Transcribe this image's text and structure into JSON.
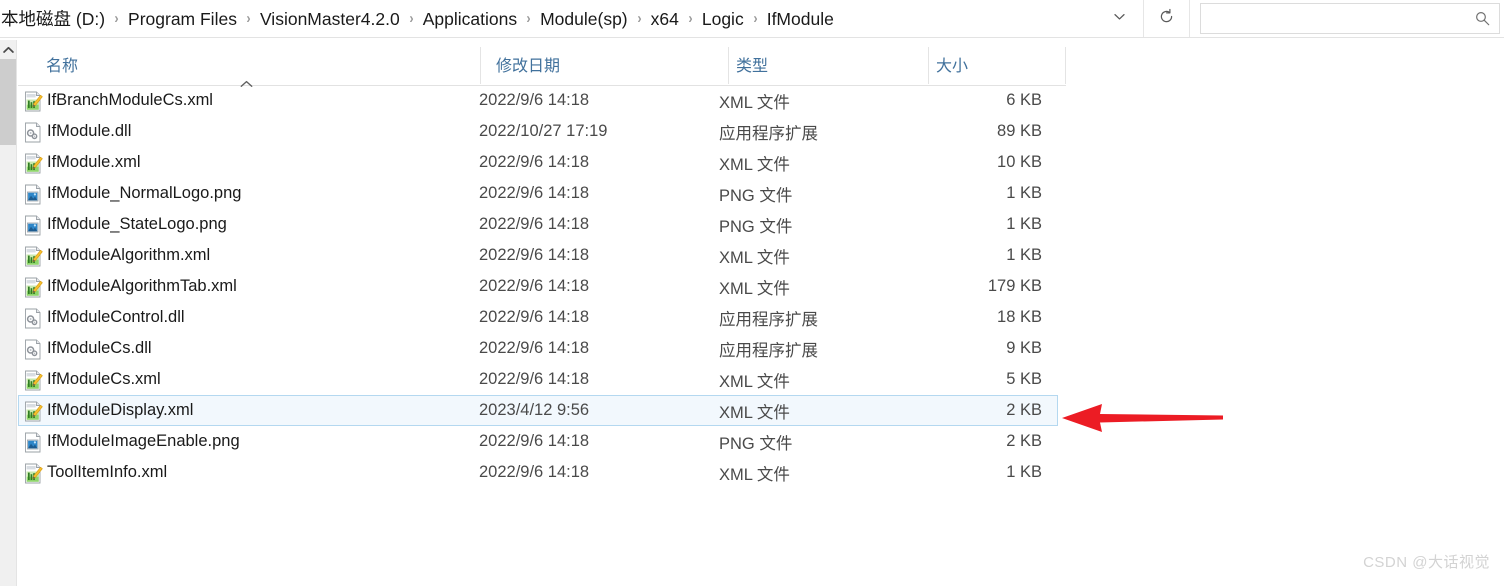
{
  "window": {
    "title": "IfModule"
  },
  "addressbar": {
    "breadcrumbs": [
      "本地磁盘 (D:)",
      "Program Files",
      "VisionMaster4.2.0",
      "Applications",
      "Module(sp)",
      "x64",
      "Logic",
      "IfModule"
    ],
    "separator": "›",
    "history_icon": "chevron-down-icon",
    "refresh_icon": "refresh-icon",
    "search": {
      "value": "",
      "placeholder": "",
      "icon": "search-icon"
    }
  },
  "scrollbar": {
    "up_arrow": "⌃"
  },
  "filelist": {
    "columns": [
      {
        "key": "name",
        "label": "名称"
      },
      {
        "key": "date",
        "label": "修改日期"
      },
      {
        "key": "type",
        "label": "类型"
      },
      {
        "key": "size",
        "label": "大小"
      }
    ],
    "sort": {
      "column": "名称",
      "direction": "asc",
      "marker": "⌃"
    },
    "rows": [
      {
        "name": "IfBranchModuleCs.xml",
        "date": "2022/9/6 14:18",
        "type": "XML 文件",
        "size": "6 KB",
        "icon": "xml-file-icon",
        "selected": false
      },
      {
        "name": "IfModule.dll",
        "date": "2022/10/27 17:19",
        "type": "应用程序扩展",
        "size": "89 KB",
        "icon": "dll-file-icon",
        "selected": false
      },
      {
        "name": "IfModule.xml",
        "date": "2022/9/6 14:18",
        "type": "XML 文件",
        "size": "10 KB",
        "icon": "xml-file-icon",
        "selected": false
      },
      {
        "name": "IfModule_NormalLogo.png",
        "date": "2022/9/6 14:18",
        "type": "PNG 文件",
        "size": "1 KB",
        "icon": "png-file-icon",
        "selected": false
      },
      {
        "name": "IfModule_StateLogo.png",
        "date": "2022/9/6 14:18",
        "type": "PNG 文件",
        "size": "1 KB",
        "icon": "png-file-icon",
        "selected": false
      },
      {
        "name": "IfModuleAlgorithm.xml",
        "date": "2022/9/6 14:18",
        "type": "XML 文件",
        "size": "1 KB",
        "icon": "xml-file-icon",
        "selected": false
      },
      {
        "name": "IfModuleAlgorithmTab.xml",
        "date": "2022/9/6 14:18",
        "type": "XML 文件",
        "size": "179 KB",
        "icon": "xml-file-icon",
        "selected": false
      },
      {
        "name": "IfModuleControl.dll",
        "date": "2022/9/6 14:18",
        "type": "应用程序扩展",
        "size": "18 KB",
        "icon": "dll-file-icon",
        "selected": false
      },
      {
        "name": "IfModuleCs.dll",
        "date": "2022/9/6 14:18",
        "type": "应用程序扩展",
        "size": "9 KB",
        "icon": "dll-file-icon",
        "selected": false
      },
      {
        "name": "IfModuleCs.xml",
        "date": "2022/9/6 14:18",
        "type": "XML 文件",
        "size": "5 KB",
        "icon": "xml-file-icon",
        "selected": false
      },
      {
        "name": "IfModuleDisplay.xml",
        "date": "2023/4/12 9:56",
        "type": "XML 文件",
        "size": "2 KB",
        "icon": "xml-file-icon",
        "selected": true
      },
      {
        "name": "IfModuleImageEnable.png",
        "date": "2022/9/6 14:18",
        "type": "PNG 文件",
        "size": "2 KB",
        "icon": "png-file-icon",
        "selected": false
      },
      {
        "name": "ToolItemInfo.xml",
        "date": "2022/9/6 14:18",
        "type": "XML 文件",
        "size": "1 KB",
        "icon": "xml-file-icon",
        "selected": false
      }
    ]
  },
  "annotation": {
    "arrow": {
      "name": "red-pointer-arrow",
      "color": "#ec1c24",
      "points_to": "IfModuleDisplay.xml"
    }
  },
  "watermark": {
    "text": "CSDN @大话视觉"
  },
  "colors": {
    "header_text": "#41719c",
    "selection_fill": "#f2f8fd",
    "selection_border": "#b4d8f0",
    "annotation_red": "#ec1c24"
  }
}
